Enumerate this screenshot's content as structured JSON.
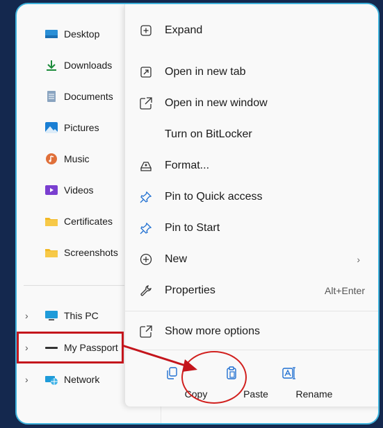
{
  "sidebar": {
    "items": [
      {
        "label": "Desktop",
        "icon": "desktop-icon"
      },
      {
        "label": "Downloads",
        "icon": "download-icon"
      },
      {
        "label": "Documents",
        "icon": "documents-icon"
      },
      {
        "label": "Pictures",
        "icon": "pictures-icon"
      },
      {
        "label": "Music",
        "icon": "music-icon"
      },
      {
        "label": "Videos",
        "icon": "videos-icon"
      },
      {
        "label": "Certificates",
        "icon": "folder-icon"
      },
      {
        "label": "Screenshots",
        "icon": "folder-icon"
      }
    ],
    "drives": [
      {
        "label": "This PC",
        "icon": "pc-icon"
      },
      {
        "label": "My Passport",
        "icon": "drive-icon"
      },
      {
        "label": "Network",
        "icon": "network-icon"
      }
    ]
  },
  "context_menu": {
    "items": [
      {
        "label": "Expand",
        "icon": "plus-square-icon"
      },
      {
        "label": "Open in new tab",
        "icon": "new-tab-icon"
      },
      {
        "label": "Open in new window",
        "icon": "new-window-icon"
      },
      {
        "label": "Turn on BitLocker",
        "icon": ""
      },
      {
        "label": "Format...",
        "icon": "format-icon"
      },
      {
        "label": "Pin to Quick access",
        "icon": "pin-icon"
      },
      {
        "label": "Pin to Start",
        "icon": "pin-icon"
      },
      {
        "label": "New",
        "icon": "plus-circle-icon"
      },
      {
        "label": "Properties",
        "icon": "wrench-icon",
        "shortcut": "Alt+Enter"
      }
    ],
    "more_options": {
      "label": "Show more options",
      "icon": "show-more-icon"
    },
    "quick_actions": [
      {
        "label": "Copy",
        "icon": "copy-icon"
      },
      {
        "label": "Paste",
        "icon": "paste-icon"
      },
      {
        "label": "Rename",
        "icon": "rename-icon"
      }
    ]
  },
  "colors": {
    "background": "#14284e",
    "window_border": "#3eb2dc",
    "annotation_red": "#c4151c",
    "accent_blue": "#1f6fd1"
  }
}
